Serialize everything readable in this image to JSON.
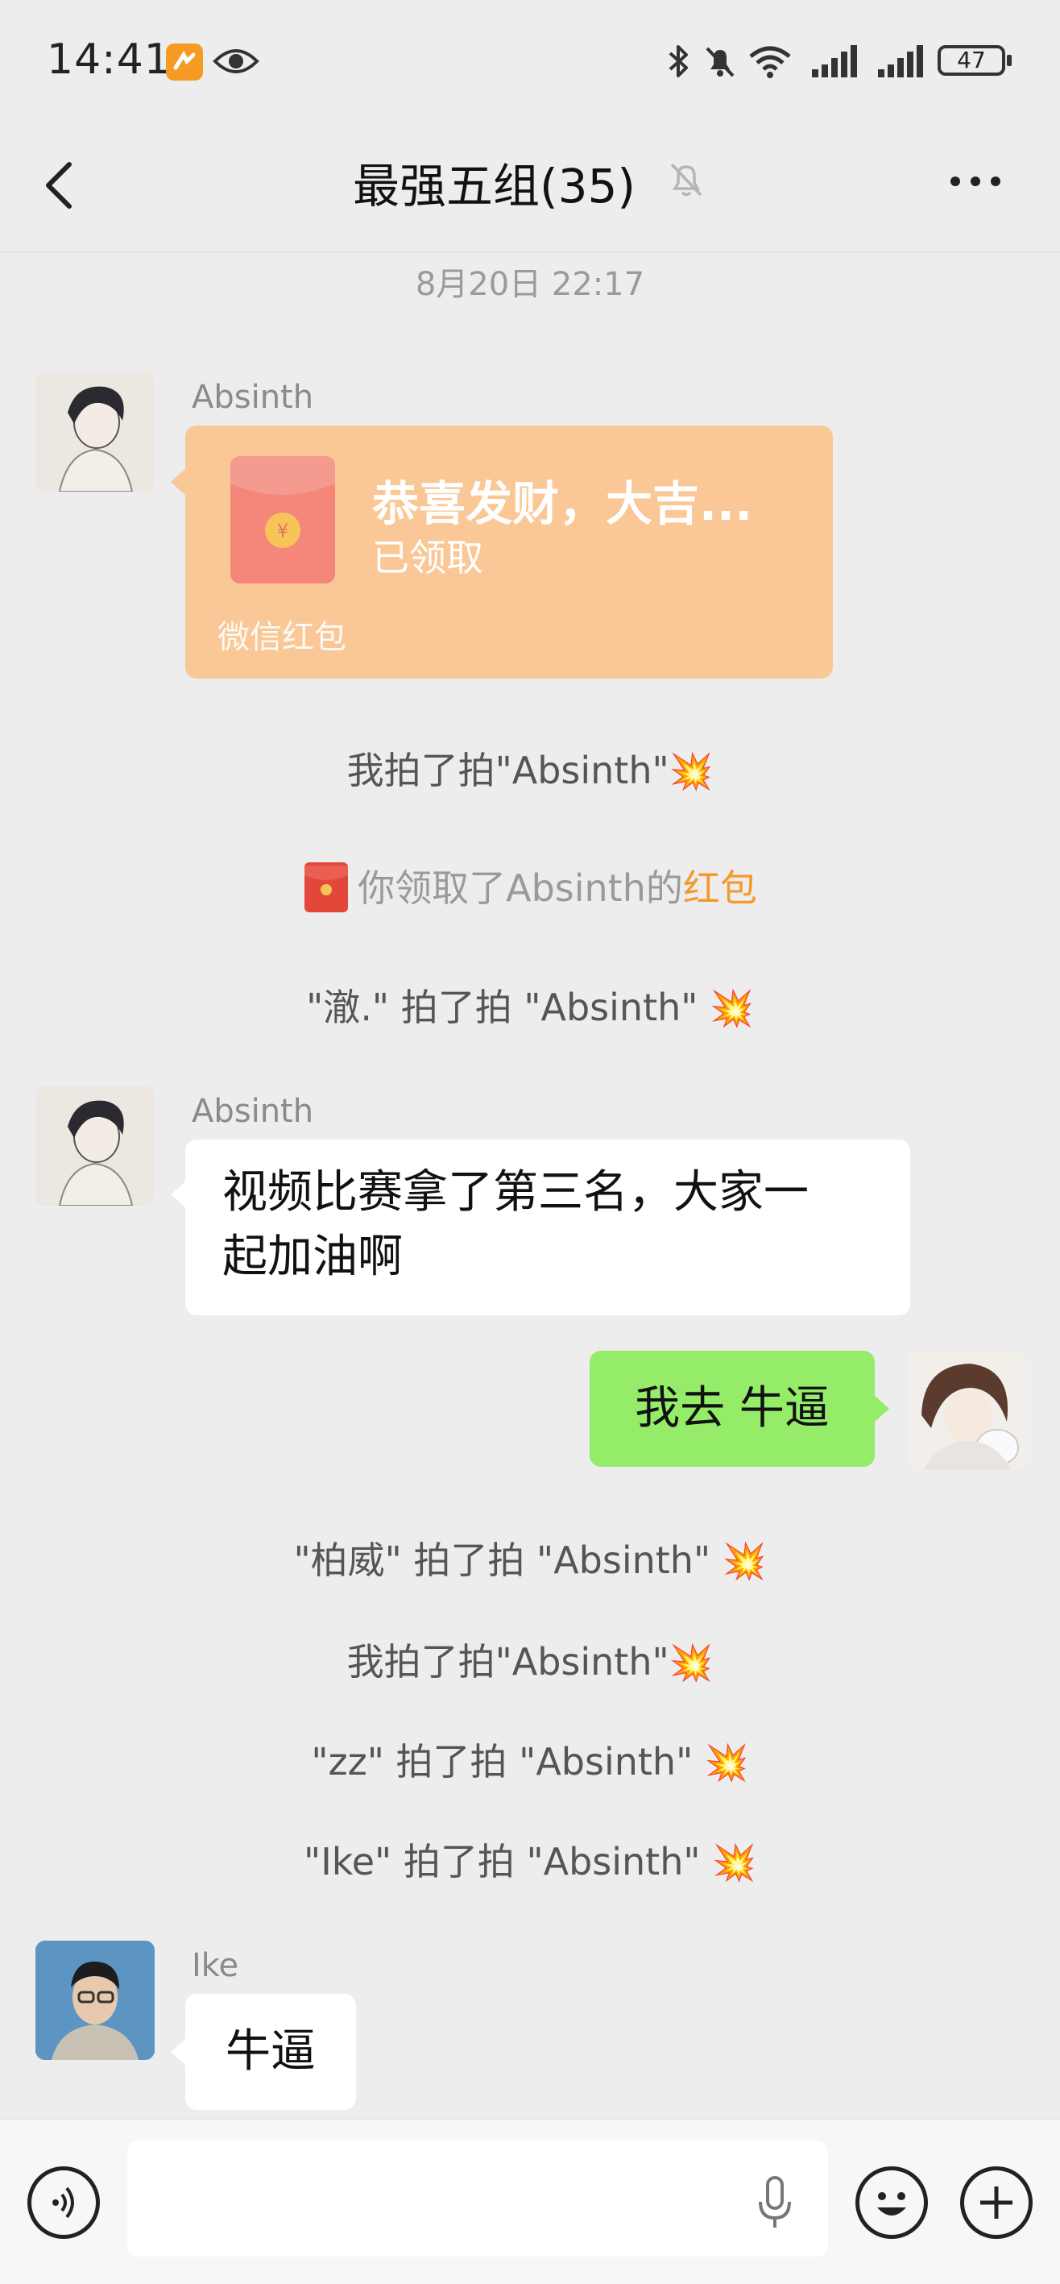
{
  "status_bar": {
    "time": "14:41",
    "battery": "47"
  },
  "nav": {
    "title": "最强五组(35)"
  },
  "chat": {
    "timestamp": "8月20日 22:17",
    "msg1": {
      "sender": "Absinth",
      "red_packet": {
        "title": "恭喜发财，大吉...",
        "status": "已领取",
        "footer": "微信红包"
      }
    },
    "sys1": "我拍了拍\"Absinth\"",
    "sys2": {
      "text": "你领取了Absinth的",
      "link": "红包"
    },
    "sys3": "\"澈.\" 拍了拍 \"Absinth\"",
    "msg2": {
      "sender": "Absinth",
      "line1": "视频比赛拿了第三名，大家一",
      "line2": "起加油啊"
    },
    "msg3": {
      "text": "我去 牛逼"
    },
    "sys4": "\"柏威\" 拍了拍 \"Absinth\"",
    "sys5": "我拍了拍\"Absinth\"",
    "sys6": "\"zz\" 拍了拍 \"Absinth\"",
    "sys7": "\"Ike\" 拍了拍 \"Absinth\"",
    "msg4": {
      "sender": "Ike",
      "text": "牛逼"
    }
  },
  "input": {
    "placeholder": ""
  },
  "colors": {
    "background": "#ededed",
    "self_bubble": "#95ec69",
    "red_packet": "#f9c896",
    "link_orange": "#f39a2b"
  }
}
